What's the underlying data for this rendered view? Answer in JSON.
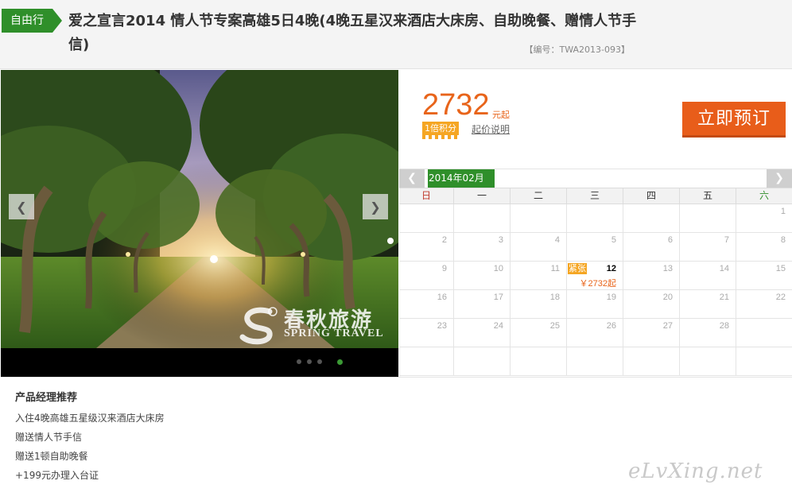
{
  "header": {
    "tag": "自由行",
    "title": "爱之宣言2014 情人节专案高雄5日4晚(4晚五星汉来酒店大床房、自助晚餐、赠情人节手信)",
    "code": "【编号：TWA2013-093】"
  },
  "gallery": {
    "watermark_cn": "春秋旅游",
    "watermark_en": "SPRING TRAVEL",
    "prev_icon": "chevron-left-icon",
    "next_icon": "chevron-right-icon",
    "slides_count": 4,
    "active_slide": 4
  },
  "pricing": {
    "price": "2732",
    "unit": "元起",
    "points_badge": "1倍积分",
    "explain_link": "起价说明",
    "book_button": "立即预订"
  },
  "calendar": {
    "month": "2014年02月",
    "weekdays": [
      "日",
      "一",
      "二",
      "三",
      "四",
      "五",
      "六"
    ],
    "rows": [
      [
        "",
        "",
        "",
        "",
        "",
        "",
        "1"
      ],
      [
        "2",
        "3",
        "4",
        "5",
        "6",
        "7",
        "8"
      ],
      [
        "9",
        "10",
        "11",
        "12",
        "13",
        "14",
        "15"
      ],
      [
        "16",
        "17",
        "18",
        "19",
        "20",
        "21",
        "22"
      ],
      [
        "23",
        "24",
        "25",
        "26",
        "27",
        "28",
        ""
      ],
      [
        "",
        "",
        "",
        "",
        "",
        "",
        ""
      ]
    ],
    "available": {
      "day": "12",
      "status": "紧张",
      "price": "￥2732起"
    }
  },
  "recommend": {
    "title": "产品经理推荐",
    "items": [
      "入住4晚高雄五星级汉来酒店大床房",
      "赠送情人节手信",
      "赠送1顿自助晚餐",
      "+199元办理入台证"
    ]
  },
  "site_watermark": "eLvXing.net",
  "colors": {
    "brand_green": "#2f8f2a",
    "price_orange": "#e8641a",
    "badge_orange": "#f5a623"
  }
}
